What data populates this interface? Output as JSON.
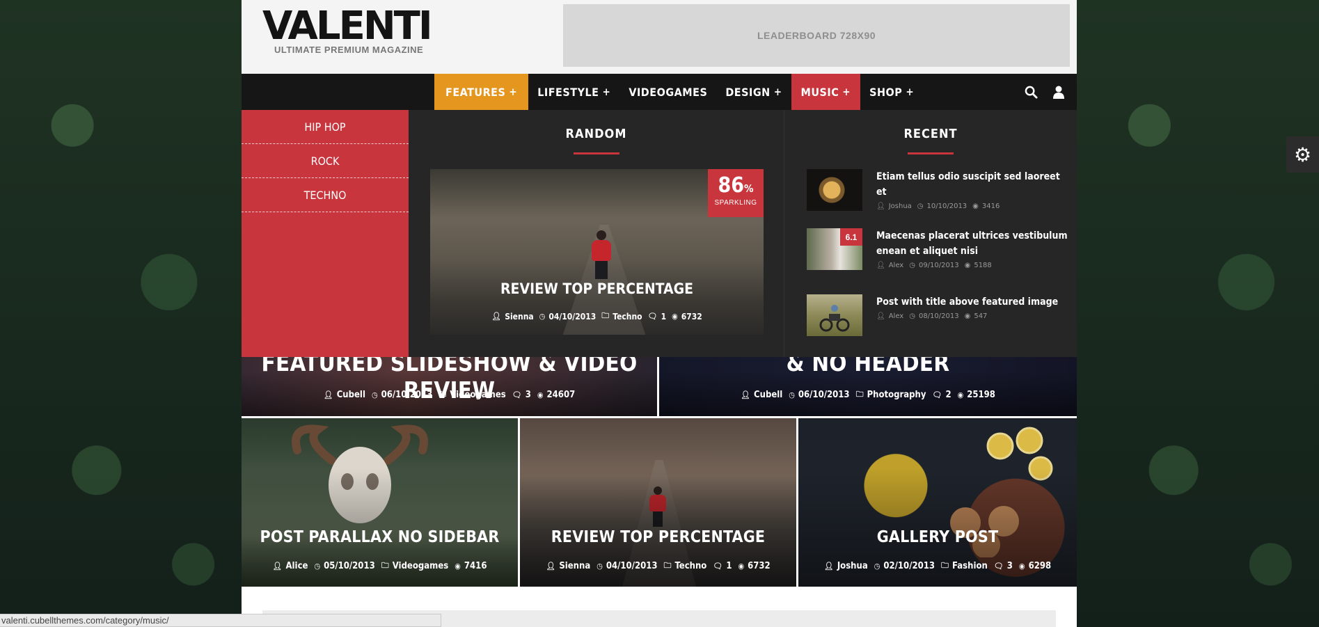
{
  "logo": {
    "main": "VALENTI",
    "sub": "ULTIMATE PREMIUM MAGAZINE"
  },
  "leaderboard": "LEADERBOARD 728X90",
  "nav": {
    "items": [
      {
        "label": "FEATURES",
        "plus": "+"
      },
      {
        "label": "LIFESTYLE",
        "plus": "+"
      },
      {
        "label": "VIDEOGAMES",
        "plus": ""
      },
      {
        "label": "DESIGN",
        "plus": "+"
      },
      {
        "label": "MUSIC",
        "plus": "+"
      },
      {
        "label": "SHOP",
        "plus": "+"
      }
    ],
    "search_icon": "search-icon",
    "user_icon": "user-icon"
  },
  "mega_menu": {
    "subcategories": [
      "HIP HOP",
      "ROCK",
      "TECHNO"
    ],
    "random": {
      "heading": "RANDOM",
      "post": {
        "title": "REVIEW TOP PERCENTAGE",
        "score": "86",
        "score_unit": "%",
        "score_label": "SPARKLING",
        "author": "Sienna",
        "date": "04/10/2013",
        "category": "Techno",
        "comments": "1",
        "views": "6732"
      }
    },
    "recent": {
      "heading": "RECENT",
      "posts": [
        {
          "title": "Etiam tellus odio suscipit sed laoreet et",
          "author": "Joshua",
          "date": "10/10/2013",
          "views": "3416",
          "score": ""
        },
        {
          "title": "Maecenas placerat ultrices vestibulum enean et aliquet nisi",
          "author": "Alex",
          "date": "09/10/2013",
          "views": "5188",
          "score": "6.1"
        },
        {
          "title": "Post with title above featured image",
          "author": "Alex",
          "date": "08/10/2013",
          "views": "547",
          "score": ""
        }
      ]
    }
  },
  "tiles": [
    {
      "title": "FEATURED SLIDESHOW & VIDEO REVIEW",
      "author": "Cubell",
      "date": "06/10/2013",
      "category": "Videogames",
      "comments": "3",
      "views": "24607"
    },
    {
      "title": "& NO HEADER",
      "author": "Cubell",
      "date": "06/10/2013",
      "category": "Photography",
      "comments": "2",
      "views": "25198"
    },
    {
      "title": "POST PARALLAX NO SIDEBAR",
      "author": "Alice",
      "date": "05/10/2013",
      "category": "Videogames",
      "comments": "",
      "views": "7416"
    },
    {
      "title": "REVIEW TOP PERCENTAGE",
      "author": "Sienna",
      "date": "04/10/2013",
      "category": "Techno",
      "comments": "1",
      "views": "6732"
    },
    {
      "title": "GALLERY POST",
      "author": "Joshua",
      "date": "02/10/2013",
      "category": "Fashion",
      "comments": "3",
      "views": "6298"
    }
  ],
  "status_bar": "valenti.cubellthemes.com/category/music/",
  "colors": {
    "accent_orange": "#e5961e",
    "accent_red": "#c9353d",
    "nav_bg": "#161616",
    "mega_bg": "#262626"
  }
}
